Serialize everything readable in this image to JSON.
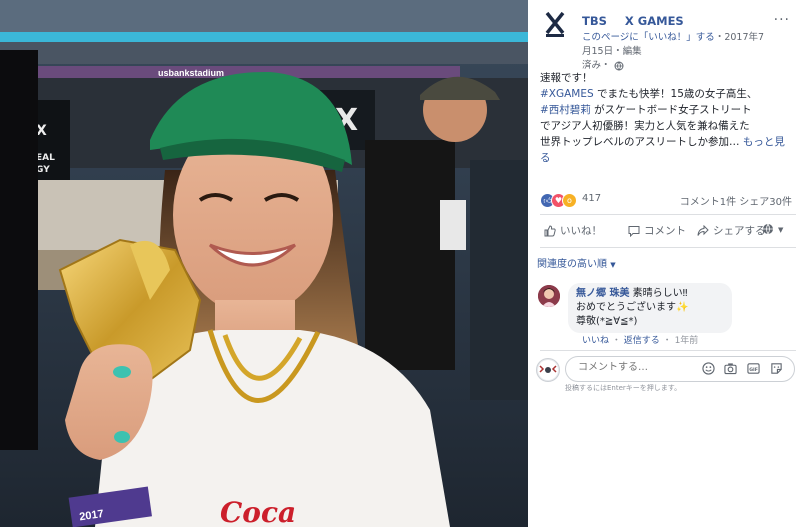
{
  "page": {
    "name_primary": "TBS",
    "name_secondary": "X GAMES",
    "meta_line1_link": "このページに「いいね！」する",
    "meta_line1_date": "・2017年7月15日・",
    "meta_line1_tail": "編集",
    "meta_line2": "済み・",
    "logo_text_top": "X",
    "logo_text_bottom": "GAMES"
  },
  "post": {
    "line1": "速報です！",
    "hashtag1": "#XGAMES",
    "line2_rest": " でまたも快挙！15歳の女子高生、",
    "mention": "#西村碧莉",
    "line3_rest": " がスケートボード女子ストリート",
    "line4": "でアジア人初優勝！実力と人気を兼ね備えた",
    "line5": "世界トップレベルのアスリートしか参加…",
    "see_more": "もっと見る"
  },
  "reactions": {
    "count": "417",
    "comments": "コメント1件",
    "shares": "シェア30件",
    "colors": {
      "like": "#4267b2",
      "love": "#f25268",
      "wow": "#f7b125"
    }
  },
  "actions": {
    "like": "いいね！",
    "comment": "コメント",
    "share": "シェアする"
  },
  "comments": {
    "sort_label": "関連度の高い順",
    "items": [
      {
        "author": "無ノ郷 珠美",
        "text1": "素晴らしい‼",
        "text2": "おめでとうございます✨",
        "text3": "尊敬(*≧∀≦*)",
        "like": "いいね",
        "reply": "返信する",
        "time": "1年前"
      }
    ]
  },
  "composer": {
    "placeholder": "コメントする…",
    "hint": "投稿するにはEnterキーを押します。"
  },
  "photo": {
    "banner": "usbankstadium",
    "sign": "X",
    "sign_text": "EAL\nGY",
    "wristband": "2017",
    "shirt": "Coca"
  }
}
